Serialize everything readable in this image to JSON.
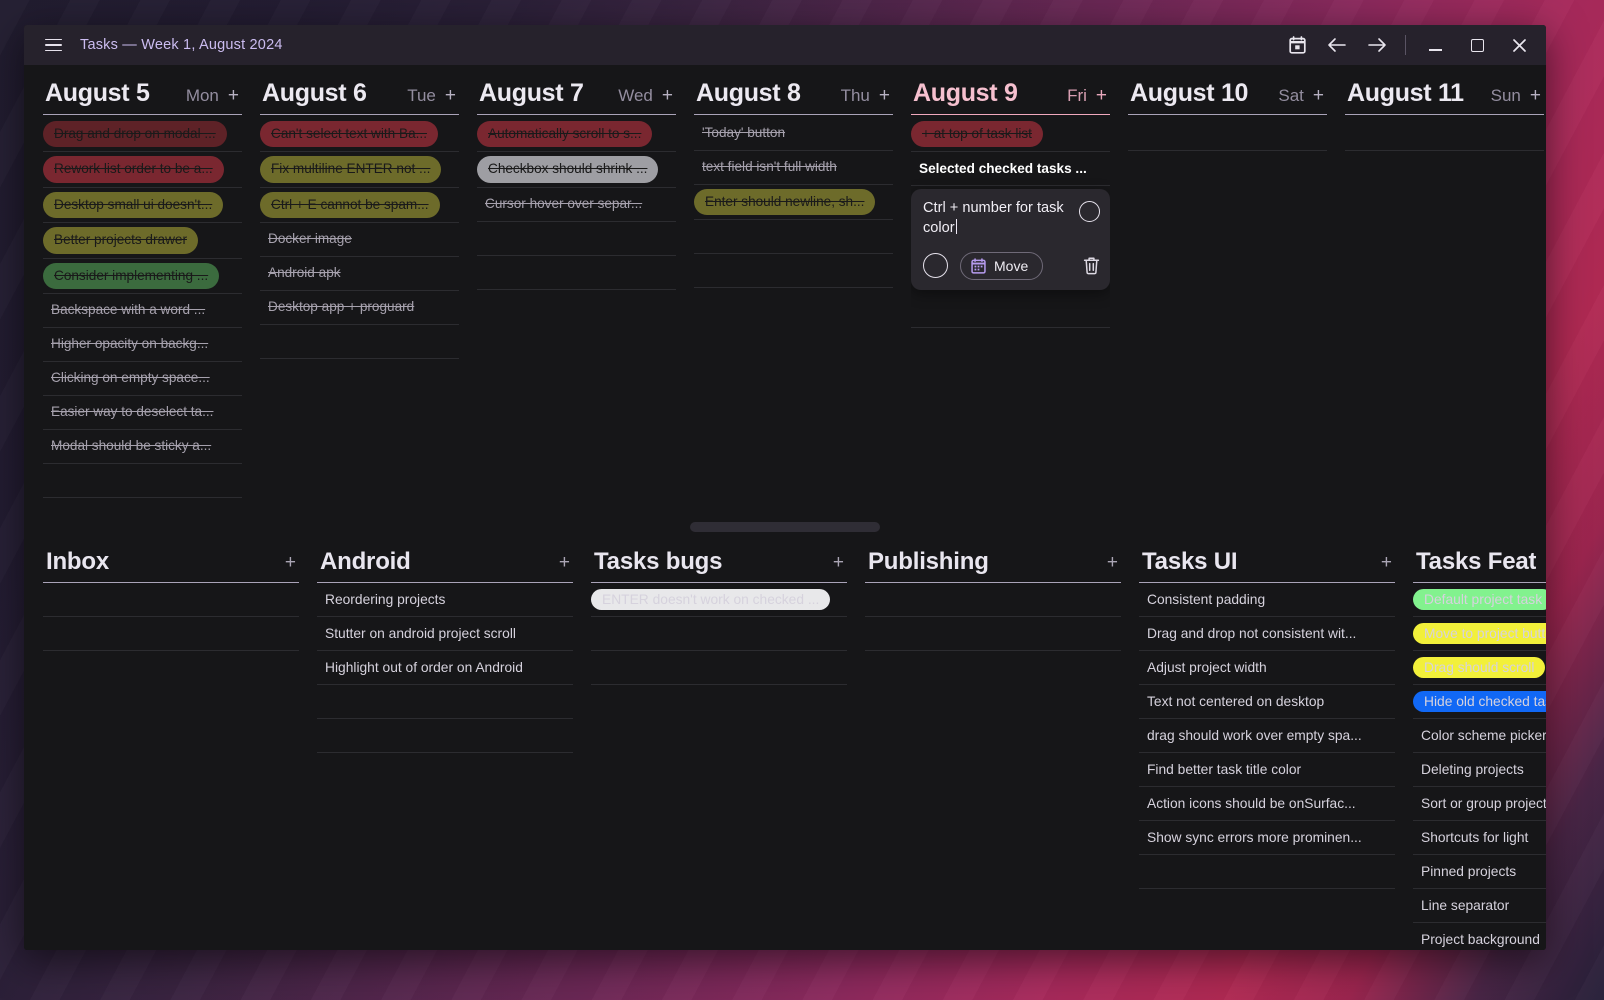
{
  "window": {
    "title": "Tasks — Week 1, August 2024",
    "menu_icon": "hamburger-icon",
    "controls": {
      "calendar_icon": "calendar-icon",
      "back_icon": "arrow-left-icon",
      "forward_icon": "arrow-right-icon",
      "minimize": "minimize-icon",
      "maximize": "maximize-icon",
      "close": "close-icon"
    }
  },
  "week": {
    "add_label": "+",
    "days": [
      {
        "date": "August 5",
        "dow": "Mon",
        "today": false,
        "tasks": [
          {
            "text": "Drag and drop on modal ...",
            "done": true,
            "chip": "chip-red"
          },
          {
            "text": "Rework list order to be a...",
            "done": true,
            "chip": "chip-darkred"
          },
          {
            "text": "Desktop small ui doesn't...",
            "done": true,
            "chip": "chip-olive"
          },
          {
            "text": "Better projects drawer",
            "done": true,
            "chip": "chip-olive"
          },
          {
            "text": "Consider implementing ...",
            "done": true,
            "chip": "chip-green"
          },
          {
            "text": "Backspace with a word ...",
            "done": true,
            "chip": ""
          },
          {
            "text": "Higher opacity on backg...",
            "done": true,
            "chip": ""
          },
          {
            "text": "Clicking on empty space...",
            "done": true,
            "chip": ""
          },
          {
            "text": "Easier way to deselect ta...",
            "done": true,
            "chip": ""
          },
          {
            "text": "Modal should be sticky a...",
            "done": true,
            "chip": ""
          }
        ]
      },
      {
        "date": "August 6",
        "dow": "Tue",
        "today": false,
        "tasks": [
          {
            "text": "Can't select text with Ba...",
            "done": true,
            "chip": "chip-darkred"
          },
          {
            "text": "Fix multiline ENTER not ...",
            "done": true,
            "chip": "chip-olive"
          },
          {
            "text": "Ctrl + E cannot be spam...",
            "done": true,
            "chip": "chip-olive"
          },
          {
            "text": "Docker image",
            "done": true,
            "chip": ""
          },
          {
            "text": "Android apk",
            "done": true,
            "chip": ""
          },
          {
            "text": "Desktop app + proguard",
            "done": true,
            "chip": ""
          }
        ]
      },
      {
        "date": "August 7",
        "dow": "Wed",
        "today": false,
        "tasks": [
          {
            "text": "Automatically scroll to s...",
            "done": true,
            "chip": "chip-darkred"
          },
          {
            "text": "Checkbox should shrink ...",
            "done": true,
            "chip": "chip-grey"
          },
          {
            "text": "Cursor hover over separ...",
            "done": true,
            "chip": ""
          }
        ]
      },
      {
        "date": "August 8",
        "dow": "Thu",
        "today": false,
        "tasks": [
          {
            "text": "'Today' button",
            "done": true,
            "chip": ""
          },
          {
            "text": "text field isn't full width",
            "done": true,
            "chip": ""
          },
          {
            "text": "Enter should newline, sh...",
            "done": true,
            "chip": "chip-olive"
          }
        ]
      },
      {
        "date": "August 9",
        "dow": "Fri",
        "today": true,
        "tasks": [
          {
            "text": "+ at top of task list",
            "done": true,
            "chip": "chip-darkred"
          },
          {
            "text": "Selected checked tasks ...",
            "done": false,
            "chip": "",
            "strong": true
          }
        ],
        "modal": {
          "text": "Ctrl + number for task color",
          "color_circle": "color-swatch-icon",
          "checkbox": "checkbox-circle-icon",
          "move_label": "Move",
          "move_icon": "calendar-icon",
          "delete_icon": "trash-icon"
        }
      },
      {
        "date": "August 10",
        "dow": "Sat",
        "today": false,
        "tasks": []
      },
      {
        "date": "August 11",
        "dow": "Sun",
        "today": false,
        "tasks": []
      }
    ]
  },
  "splitter": {
    "handle": "pane-resize-handle"
  },
  "projects": {
    "add_label": "+",
    "columns": [
      {
        "title": "Inbox",
        "tasks": []
      },
      {
        "title": "Android",
        "tasks": [
          {
            "text": "Reordering projects",
            "chip": ""
          },
          {
            "text": "Stutter on android project scroll",
            "chip": ""
          },
          {
            "text": "Highlight out of order on Android",
            "chip": ""
          }
        ]
      },
      {
        "title": "Tasks bugs",
        "tasks": [
          {
            "text": "ENTER doesn't work on checked ...",
            "chip": "chip-bright-white"
          }
        ]
      },
      {
        "title": "Publishing",
        "tasks": []
      },
      {
        "title": "Tasks UI",
        "tasks": [
          {
            "text": "Consistent padding",
            "chip": ""
          },
          {
            "text": "Drag and drop not consistent wit...",
            "chip": ""
          },
          {
            "text": "Adjust project width",
            "chip": ""
          },
          {
            "text": "Text not centered on desktop",
            "chip": ""
          },
          {
            "text": "drag should work over empty spa...",
            "chip": ""
          },
          {
            "text": "Find better task title color",
            "chip": ""
          },
          {
            "text": "Action icons should be onSurfac...",
            "chip": ""
          },
          {
            "text": "Show sync errors more prominen...",
            "chip": ""
          }
        ]
      },
      {
        "title": "Tasks Feat",
        "tasks": [
          {
            "text": "Default project task",
            "chip": "chip-bright-green"
          },
          {
            "text": "Move to project button",
            "chip": "chip-bright-yellow"
          },
          {
            "text": "Drag should scroll",
            "chip": "chip-bright-yellow"
          },
          {
            "text": "Hide old checked tasks",
            "chip": "chip-bright-blue"
          },
          {
            "text": "Color scheme picker",
            "chip": ""
          },
          {
            "text": "Deleting projects",
            "chip": ""
          },
          {
            "text": "Sort or group projects",
            "chip": ""
          },
          {
            "text": "Shortcuts for light",
            "chip": ""
          },
          {
            "text": "Pinned projects",
            "chip": ""
          },
          {
            "text": "Line separator",
            "chip": ""
          },
          {
            "text": "Project background",
            "chip": ""
          }
        ]
      }
    ]
  },
  "theme": {
    "accent": "#cbbcf0",
    "today": "#f6c0cf",
    "surface": "#161618",
    "titlebar": "#26222c"
  }
}
